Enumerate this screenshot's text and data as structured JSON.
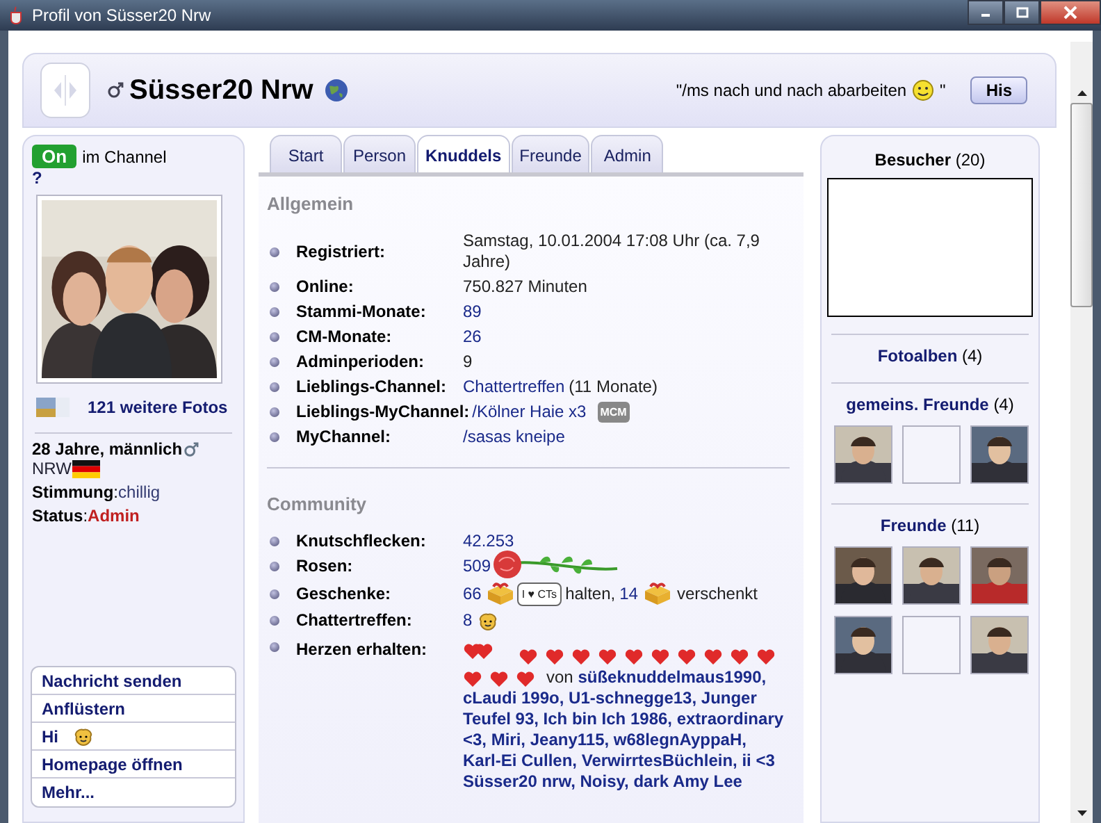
{
  "window": {
    "title": "Profil von Süsser20 Nrw"
  },
  "header": {
    "name": "Süsser20 Nrw",
    "status_text": "\"/ms nach und nach abarbeiten",
    "status_end": "\"",
    "button": "His"
  },
  "left": {
    "online": true,
    "online_label": "On",
    "channel_text": "im Channel",
    "channel_name": "?",
    "photos_link": "121 weitere Fotos",
    "age": "28 Jahre, männlich",
    "region": "NRW",
    "mood_label": "**Stimmung**:",
    "mood": "chillig",
    "status_label": "**Status**:",
    "status": "Admin",
    "actions": [
      {
        "kind": "link",
        "label": "Nachricht senden"
      },
      {
        "kind": "link",
        "label": "Anflüstern"
      },
      {
        "kind": "greeting",
        "label": "Hi"
      },
      {
        "kind": "link",
        "label": "Homepage öffnen"
      },
      {
        "kind": "link",
        "label": "Mehr..."
      }
    ]
  },
  "tabs": [
    {
      "label": "Start",
      "selected": false
    },
    {
      "label": "Person",
      "selected": false
    },
    {
      "label": "Knuddels",
      "selected": true
    },
    {
      "label": "Freunde",
      "selected": false
    },
    {
      "label": "Admin",
      "selected": false
    }
  ],
  "general": {
    "title": "Allgemein",
    "rows": [
      {
        "label": "Registriert:",
        "value": "Samstag, 10.01.2004 17:08 Uhr (ca. 7,9 Jahre)",
        "link": false
      },
      {
        "label": "Online:",
        "value": "750.827 Minuten",
        "link": false
      },
      {
        "label": "Stammi-Monate:",
        "value": "89",
        "link": true
      },
      {
        "label": "CM-Monate:",
        "value": "26",
        "link": true
      },
      {
        "label": "Adminperioden:",
        "value": "9",
        "link": false
      },
      {
        "label": "Lieblings-Channel:",
        "value": "Chattertreffen",
        "link": true,
        "extra": " (11 Monate)"
      },
      {
        "label": "Lieblings-MyChannel:",
        "value": "/Kölner Haie x3",
        "link": true,
        "badge": "MCM"
      },
      {
        "label": "MyChannel:",
        "value": "/sasas kneipe",
        "link": true
      }
    ]
  },
  "community": {
    "title": "Community",
    "kisses": {
      "label": "Knutschflecken:",
      "value": "42.253"
    },
    "roses": {
      "label": "Rosen:",
      "value": "509"
    },
    "gifts": {
      "label": "Geschenke:",
      "received": "66",
      "tag": "I ♥ CTs",
      "received_label": "halten,",
      "given": "14",
      "given_label": "verschenkt"
    },
    "meetings": {
      "label": "Chattertreffen:",
      "value": "8"
    },
    "hearts": {
      "label": "Herzen erhalten:",
      "from": "von **süßeknuddelmaus1990, cLaudi 199o, U1-schnegge13, Junger Teufel 93, Ich bin Ich 1986, extraordinary <3, Miri, Jeany115, w68legnAyppaH, Karl-Ei Cullen, VerwirrtesBüchlein, ii <3 Süsser20 nrw, Noisy, dark Amy Lee**"
    }
  },
  "right": {
    "visitors_label": "Besucher",
    "visitors_count": "(20)",
    "albums_label": "Fotoalben",
    "albums_count": "(4)",
    "common_label": "gemeins. Freunde",
    "common_count": "(4)",
    "common": [
      {
        "kind": "picture"
      },
      {
        "kind": "empty"
      },
      {
        "kind": "picture"
      }
    ],
    "friends_label": "Freunde",
    "friends_count": "(11)",
    "friends": [
      {
        "kind": "picture"
      },
      {
        "kind": "picture"
      },
      {
        "kind": "picture"
      },
      {
        "kind": "picture"
      },
      {
        "kind": "empty"
      },
      {
        "kind": "picture"
      }
    ]
  }
}
